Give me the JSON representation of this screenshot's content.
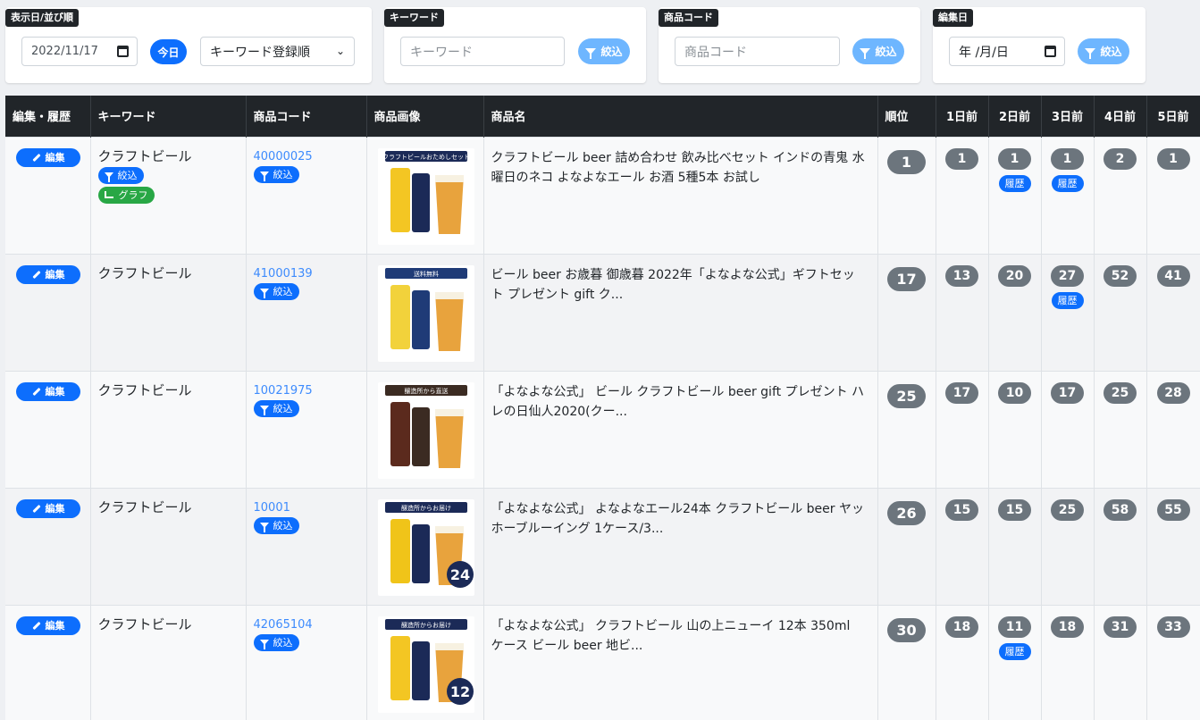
{
  "filters": {
    "date_sort": {
      "tag": "表示日/並び順",
      "date_value": "2022/11/17",
      "today_label": "今日",
      "sort_selected": "キーワード登録順"
    },
    "keyword": {
      "tag": "キーワード",
      "placeholder": "キーワード",
      "button_label": "絞込"
    },
    "product_code": {
      "tag": "商品コード",
      "placeholder": "商品コード",
      "button_label": "絞込"
    },
    "edit_date": {
      "tag": "編集日",
      "placeholder": "年 /月/日",
      "button_label": "絞込"
    }
  },
  "table": {
    "headers": [
      "編集・履歴",
      "キーワード",
      "商品コード",
      "商品画像",
      "商品名",
      "順位",
      "1日前",
      "2日前",
      "3日前",
      "4日前",
      "5日前"
    ],
    "labels": {
      "edit": "編集",
      "filter": "絞込",
      "graph": "グラフ",
      "history": "履歴"
    },
    "rows": [
      {
        "keyword": "クラフトビール",
        "code": "40000025",
        "name": "クラフトビール beer 詰め合わせ 飲み比べセット インドの青鬼 水曜日のネコ よなよなエール お酒 5種5本 お試し",
        "rank": "1",
        "days": [
          "1",
          "1",
          "1",
          "2",
          "1"
        ],
        "history": [
          false,
          true,
          true,
          false,
          false
        ],
        "image_text": "クラフトビールおためしセット",
        "image_sub": ""
      },
      {
        "keyword": "クラフトビール",
        "code": "41000139",
        "name": "ビール beer お歳暮 御歳暮 2022年「よなよな公式」ギフトセット プレゼント gift ク...",
        "rank": "17",
        "days": [
          "13",
          "20",
          "27",
          "52",
          "41"
        ],
        "history": [
          false,
          false,
          true,
          false,
          false
        ],
        "image_text": "送料無料",
        "image_sub": ""
      },
      {
        "keyword": "クラフトビール",
        "code": "10021975",
        "name": "「よなよな公式」 ビール クラフトビール beer gift プレゼント ハレの日仙人2020(クー...",
        "rank": "25",
        "days": [
          "17",
          "10",
          "17",
          "25",
          "28"
        ],
        "history": [
          false,
          false,
          false,
          false,
          false
        ],
        "image_text": "醸造所から直送",
        "image_sub": ""
      },
      {
        "keyword": "クラフトビール",
        "code": "10001",
        "name": "「よなよな公式」 よなよなエール24本 クラフトビール beer ヤッホーブルーイング 1ケース/3...",
        "rank": "26",
        "days": [
          "15",
          "15",
          "25",
          "58",
          "55"
        ],
        "history": [
          false,
          false,
          false,
          false,
          false
        ],
        "image_text": "醸造所からお届け",
        "image_sub": "24"
      },
      {
        "keyword": "クラフトビール",
        "code": "42065104",
        "name": "「よなよな公式」 クラフトビール 山の上ニューイ 12本 350ml ケース ビール beer 地ビ...",
        "rank": "30",
        "days": [
          "18",
          "11",
          "18",
          "31",
          "33"
        ],
        "history": [
          false,
          true,
          false,
          false,
          false
        ],
        "image_text": "醸造所からお届け",
        "image_sub": "12"
      }
    ]
  }
}
